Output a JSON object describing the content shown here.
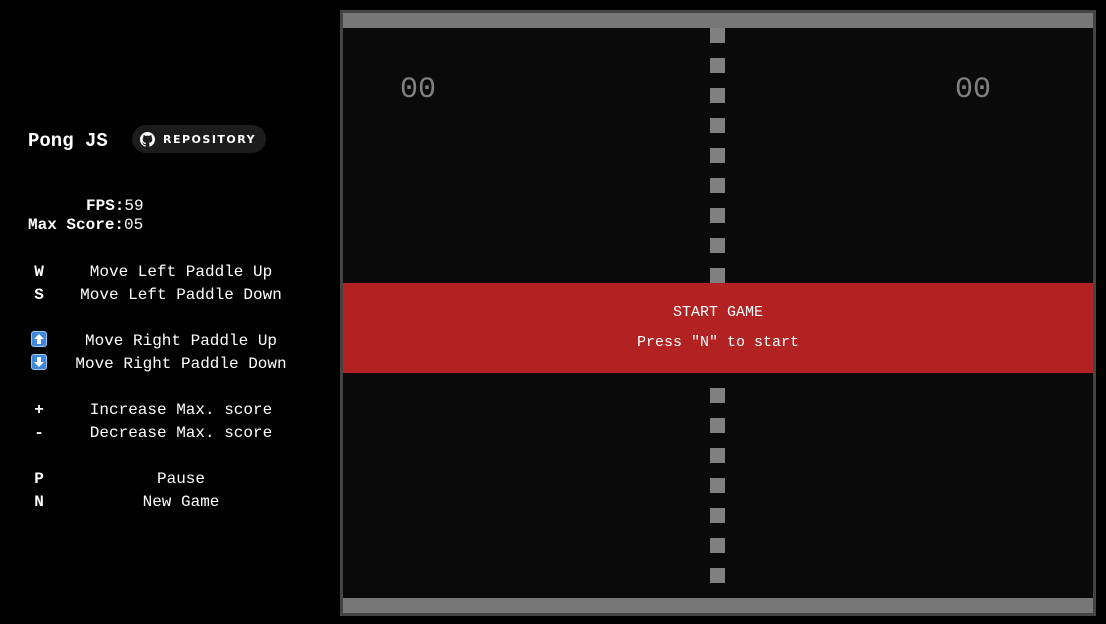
{
  "sidebar": {
    "title": "Pong JS",
    "repo_label": "REPOSITORY",
    "fps_label": "FPS:",
    "fps_value": "59",
    "max_score_label": "Max Score:",
    "max_score_value": "05",
    "controls": [
      {
        "key": "W",
        "desc": "Move Left Paddle Up"
      },
      {
        "key": "S",
        "desc": "Move Left Paddle Down"
      },
      {
        "key_icon": "up-arrow-icon",
        "desc": "Move Right Paddle Up"
      },
      {
        "key_icon": "down-arrow-icon",
        "desc": "Move Right Paddle Down"
      },
      {
        "key": "+",
        "desc": "Increase Max. score"
      },
      {
        "key": "-",
        "desc": "Decrease Max. score"
      },
      {
        "key": "P",
        "desc": "Pause"
      },
      {
        "key": "N",
        "desc": "New Game"
      }
    ]
  },
  "game": {
    "score_left": "00",
    "score_right": "00",
    "overlay_title": "START GAME",
    "overlay_hint": "Press \"N\" to start"
  },
  "colors": {
    "background": "#000000",
    "field": "#0a0a0a",
    "wall": "#777777",
    "net": "#808080",
    "overlay": "#b22222",
    "arrow_key": "#3f88d9"
  }
}
